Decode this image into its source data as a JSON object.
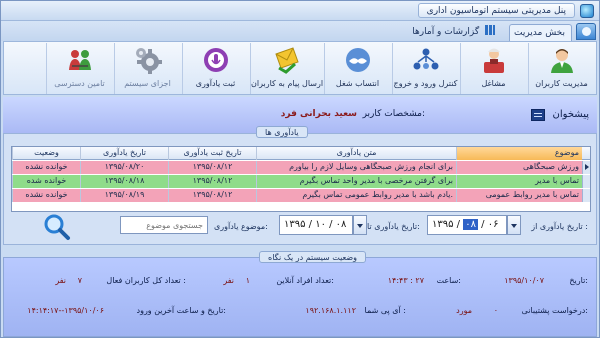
{
  "window": {
    "title": "پنل مدیریتی سیستم اتوماسیون اداری"
  },
  "tabs": [
    {
      "label": "بخش مدیریت",
      "active": true
    },
    {
      "label": "گزارشات و آمارها",
      "active": false
    }
  ],
  "ribbon": [
    {
      "label": "مدیریت کاربران",
      "icon": "users-management-icon"
    },
    {
      "label": "مشاغل",
      "icon": "jobs-icon"
    },
    {
      "label": "کنترل ورود و خروج",
      "icon": "entry-exit-control-icon"
    },
    {
      "label": "انتساب شغل",
      "icon": "job-assignment-icon"
    },
    {
      "label": "ارسال پیام به کاربران",
      "icon": "send-message-icon"
    },
    {
      "label": "ثبت یادآوری",
      "icon": "reminder-icon"
    },
    {
      "label": "اجزای سیستم",
      "icon": "system-components-icon"
    },
    {
      "label": "تامین دسترسی",
      "icon": "access-provision-icon"
    }
  ],
  "header": {
    "inbox_label": "پیشخوان",
    "user_caption": "مشخصات کاربر:",
    "user_name": "سعید بحرانی فرد"
  },
  "reminders": {
    "group_title": "یادآوری ها",
    "columns": [
      "موضوع",
      "متن یادآوری",
      "تاریخ ثبت یادآوری",
      "تاریخ یادآوری",
      "وضعیت"
    ],
    "rows": [
      {
        "topic": "ورزش صبحگاهی",
        "text": "برای انجام ورزش صبحگاهی وسایل لازم را بیاورم",
        "created": "۱۳۹۵/۰۸/۱۲",
        "date": "۱۳۹۵/۰۸/۲۰",
        "status": "خوانده نشده"
      },
      {
        "topic": "تماس با مدیر",
        "text": "برای گرفتن مرخصی با مدیر واحد تماس بگیرم",
        "created": "۱۳۹۵/۰۸/۱۲",
        "date": "۱۳۹۵/۰۸/۱۸",
        "status": "خوانده شده"
      },
      {
        "topic": "تماس با مدیر روابط عمومی",
        "text": "یادم باشد با مدیر روابط عمومی تماس بگیرم.",
        "created": "۱۳۹۵/۰۸/۱۲",
        "date": "۱۳۹۵/۰۸/۱۹",
        "status": "خوانده نشده"
      }
    ],
    "colors": {
      "unread_row": "#f3a3b8",
      "read_row": "#8fdc8a",
      "topic_header": "#f7b957"
    }
  },
  "filter": {
    "from_label": "تاریخ یادآوری از :",
    "from_date_prefix": "۱۳۹۵ /",
    "from_date_highlight": "۰۸",
    "from_date_suffix": "/ ۰۶",
    "to_label": "تاریخ یادآوری تا:",
    "to_date": "۱۳۹۵ / ۱۰ / ۰۸",
    "topic_label": "موضوع یادآوری:",
    "topic_placeholder": "جستجوی موضوع"
  },
  "status": {
    "group_title": "وضعیت سیستم در یک نگاه",
    "date_label": "تاریخ:",
    "date_value": "۱۳۹۵/۱۰/۰۷",
    "time_label": "ساعت:",
    "time_value": "۱۴:۴۳ : ۲۷",
    "online_label": "تعداد افراد آنلاین:",
    "online_value": "۱",
    "online_unit": "نفر",
    "active_label": "تعداد کل کاربران فعال :",
    "active_value": "۷",
    "active_unit": "نفر",
    "support_label": "درخواست پشتیبانی:",
    "support_value": "۰",
    "support_unit": "مورد",
    "ip_label": "آی پی شما :",
    "ip_value": "۱۹۲.۱۶۸.۱.۱۱۲",
    "last_login_label": "تاریخ و ساعت آخرین ورود:",
    "last_login_value": "۱۴:۱۴:۱۷--۱۳۹۵/۱۰/۰۶"
  }
}
